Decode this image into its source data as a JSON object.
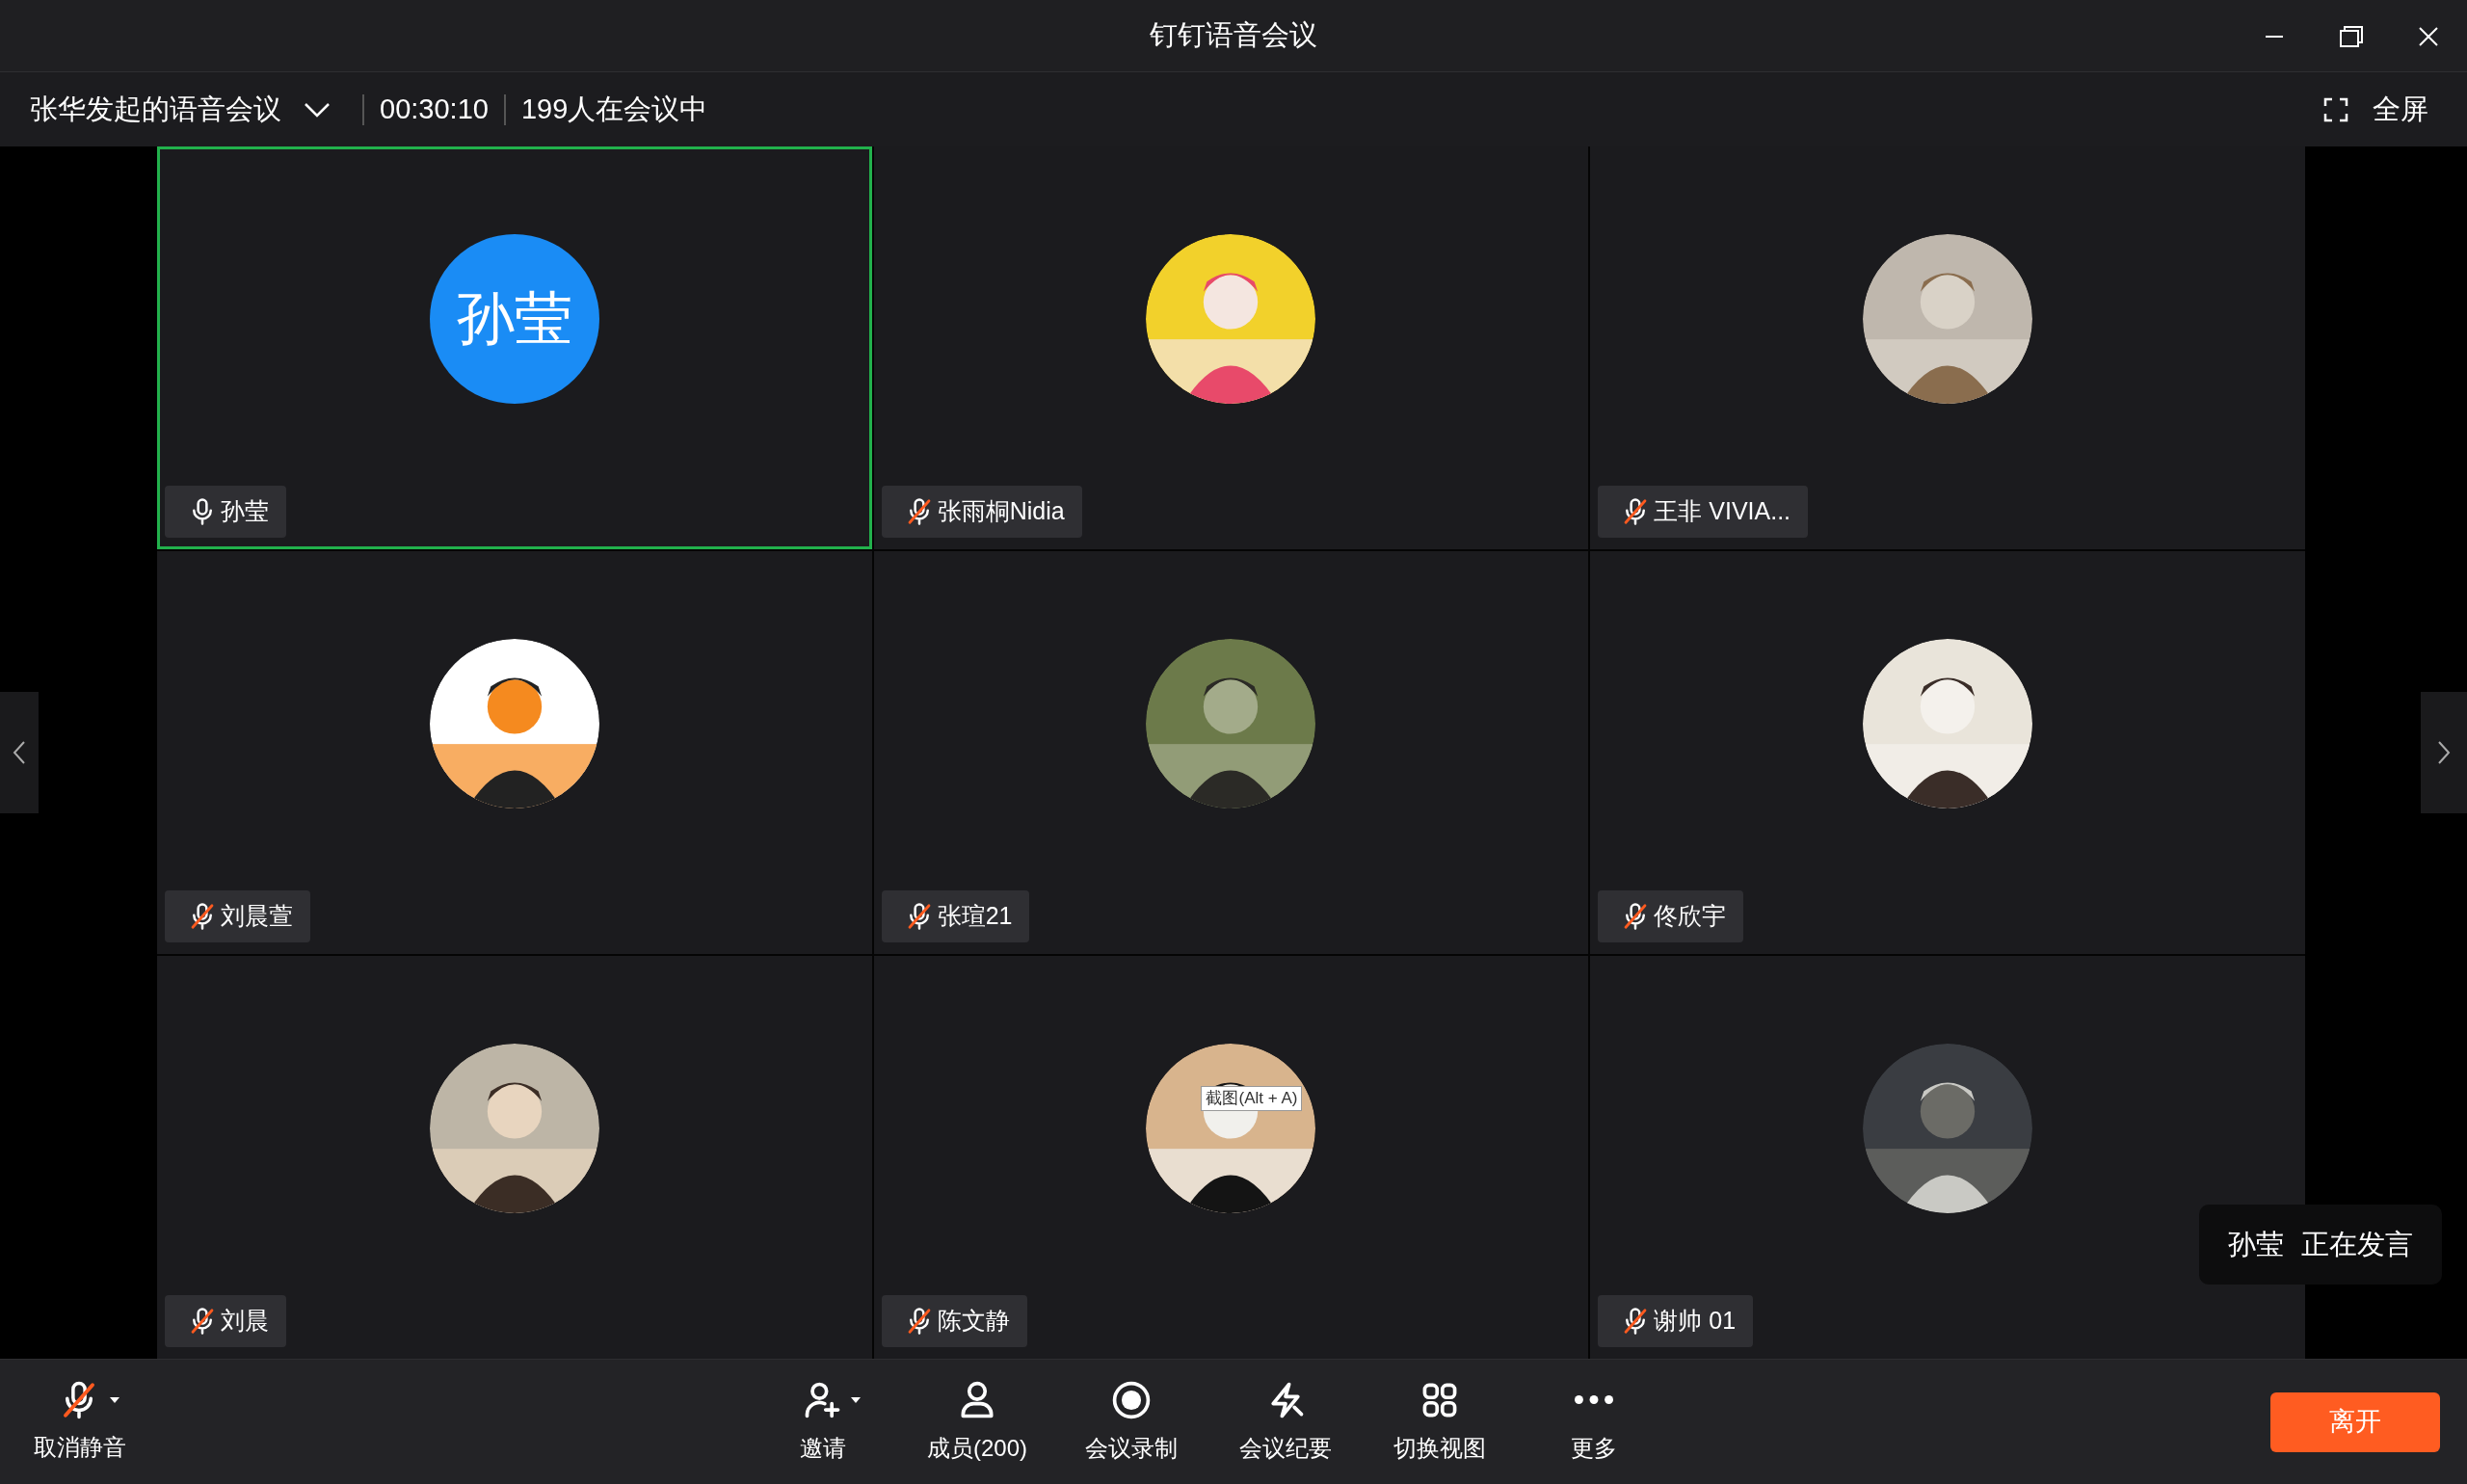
{
  "window": {
    "title": "钉钉语音会议"
  },
  "meeting": {
    "title": "张华发起的语音会议",
    "duration": "00:30:10",
    "attendance": "199人在会议中",
    "fullscreen": "全屏"
  },
  "participants": [
    {
      "name": "孙莹",
      "muted": false,
      "speaking": true,
      "avatar": {
        "kind": "initials",
        "text": "孙莹"
      }
    },
    {
      "name": "张雨桐Nidia",
      "muted": true,
      "speaking": false
    },
    {
      "name": "王非 VIVIA...",
      "muted": true,
      "speaking": false
    },
    {
      "name": "刘晨萱",
      "muted": true,
      "speaking": false
    },
    {
      "name": "张瑄21",
      "muted": true,
      "speaking": false
    },
    {
      "name": "佟欣宇",
      "muted": true,
      "speaking": false
    },
    {
      "name": "刘晨",
      "muted": true,
      "speaking": false
    },
    {
      "name": "陈文静",
      "muted": true,
      "speaking": false,
      "tooltip": "截图(Alt + A)"
    },
    {
      "name": "谢帅 01",
      "muted": true,
      "speaking": false
    }
  ],
  "toast": {
    "name": "孙莹",
    "text": "正在发言"
  },
  "toolbar": {
    "mute": {
      "label": "取消静音",
      "muted": true
    },
    "actions": [
      {
        "kind": "invite",
        "label": "邀请",
        "menu": true
      },
      {
        "kind": "members",
        "label": "成员(200)",
        "menu": false
      },
      {
        "kind": "record",
        "label": "会议录制",
        "menu": false
      },
      {
        "kind": "minutes",
        "label": "会议纪要",
        "menu": false
      },
      {
        "kind": "view",
        "label": "切换视图",
        "menu": false
      },
      {
        "kind": "more",
        "label": "更多",
        "menu": false
      }
    ],
    "leave": "离开"
  }
}
